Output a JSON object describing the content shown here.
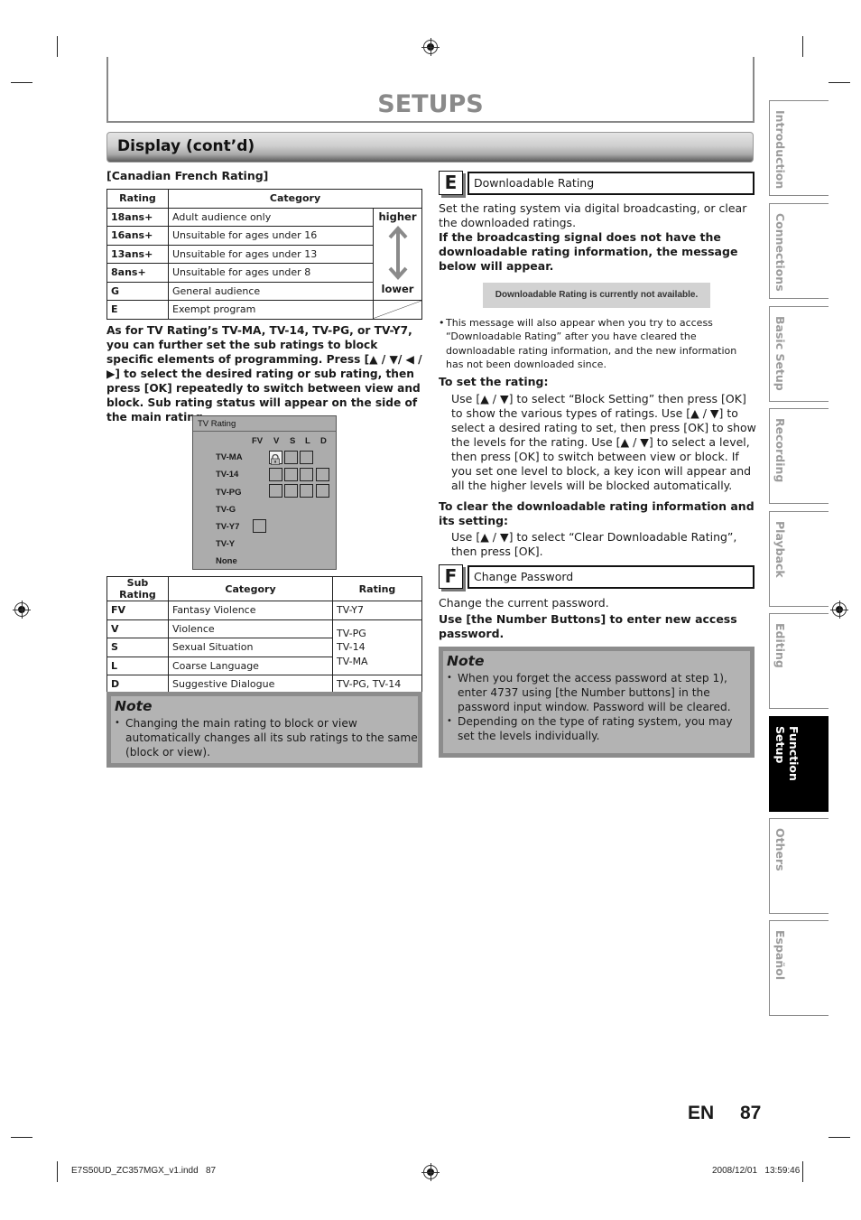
{
  "header": {
    "title": "SETUPS"
  },
  "section": {
    "title": "Display (cont’d)"
  },
  "canadian_french": {
    "heading": "[Canadian French Rating]",
    "columns": [
      "Rating",
      "Category"
    ],
    "higher_label": "higher",
    "lower_label": "lower",
    "rows": [
      {
        "rating": "18ans+",
        "category": "Adult audience only"
      },
      {
        "rating": "16ans+",
        "category": "Unsuitable for ages under 16"
      },
      {
        "rating": "13ans+",
        "category": "Unsuitable for ages under 13"
      },
      {
        "rating": "8ans+",
        "category": "Unsuitable for ages under 8"
      },
      {
        "rating": "G",
        "category": "General audience"
      },
      {
        "rating": "E",
        "category": "Exempt program"
      }
    ]
  },
  "tv_paragraph": "As for TV Rating’s TV-MA, TV-14, TV-PG, or TV-Y7, you can further set the sub ratings to block specific elements of programming. Press [▲ / ▼/ ◀ / ▶] to select the desired rating or sub rating, then press [OK] repeatedly to switch between view and block. Sub rating status will appear on the side of the main rating.",
  "tv_screen": {
    "title": "TV Rating",
    "columns": [
      "FV",
      "V",
      "S",
      "L",
      "D"
    ],
    "levels": [
      "TV-MA",
      "TV-14",
      "TV-PG",
      "TV-G",
      "TV-Y7",
      "TV-Y",
      "None"
    ]
  },
  "sub_rating_table": {
    "columns": [
      "Sub Rating",
      "Category",
      "Rating"
    ],
    "rows": [
      {
        "sub": "FV",
        "category": "Fantasy Violence",
        "rating": "TV-Y7"
      },
      {
        "sub": "V",
        "category": "Violence"
      },
      {
        "sub": "S",
        "category": "Sexual Situation"
      },
      {
        "sub": "L",
        "category": "Coarse Language"
      },
      {
        "sub": "D",
        "category": "Suggestive Dialogue",
        "rating": "TV-PG, TV-14"
      }
    ],
    "merged_rating_lines": [
      "TV-PG",
      "TV-14",
      "TV-MA"
    ]
  },
  "note_left": {
    "title": "Note",
    "items": [
      "Changing the main rating to block or view automatically changes all its sub ratings to the same (block or view)."
    ]
  },
  "section_e": {
    "letter": "E",
    "title": "Downloadable Rating",
    "intro": "Set the rating system via digital broadcasting, or clear the downloaded ratings.",
    "bold_intro": "If the broadcasting signal does not have the downloadable rating information, the message below will appear.",
    "message": "Downloadable Rating is currently not available.",
    "bullet": "This message will also appear when you try to access “Downloadable Rating” after you have cleared the downloadable rating information, and the new information has not been downloaded since.",
    "set_heading": "To set the rating:",
    "set_text": "Use [▲ / ▼] to select “Block Setting” then press [OK] to show the various types of ratings. Use [▲ / ▼] to select a desired rating to set, then press [OK] to show the levels for the rating. Use [▲ / ▼] to select a level, then press [OK] to switch between view or block. If you set one level to block, a key icon will appear and all the higher levels will be blocked automatically.",
    "clear_heading": "To clear the downloadable rating information and its setting:",
    "clear_text": "Use [▲ / ▼] to select “Clear Downloadable Rating”, then press [OK]."
  },
  "section_f": {
    "letter": "F",
    "title": "Change Password",
    "intro": "Change the current password.",
    "bold_intro": "Use [the Number Buttons] to enter new access password."
  },
  "note_right": {
    "title": "Note",
    "items": [
      "When you forget the access password at step 1), enter 4737 using [the Number buttons] in the password input window. Password will be cleared.",
      "Depending on the type of rating system, you may set the levels individually."
    ]
  },
  "side_tabs": [
    {
      "label": "Introduction",
      "active": false
    },
    {
      "label": "Connections",
      "active": false
    },
    {
      "label": "Basic Setup",
      "active": false
    },
    {
      "label": "Recording",
      "active": false
    },
    {
      "label": "Playback",
      "active": false
    },
    {
      "label": "Editing",
      "active": false
    },
    {
      "label": "Function Setup",
      "active": true
    },
    {
      "label": "Others",
      "active": false
    },
    {
      "label": "Español",
      "active": false
    }
  ],
  "page": {
    "lang": "EN",
    "number": "87"
  },
  "footer": {
    "file": "E7S50UD_ZC357MGX_v1.indd   87",
    "timestamp": "2008/12/01   13:59:46"
  }
}
